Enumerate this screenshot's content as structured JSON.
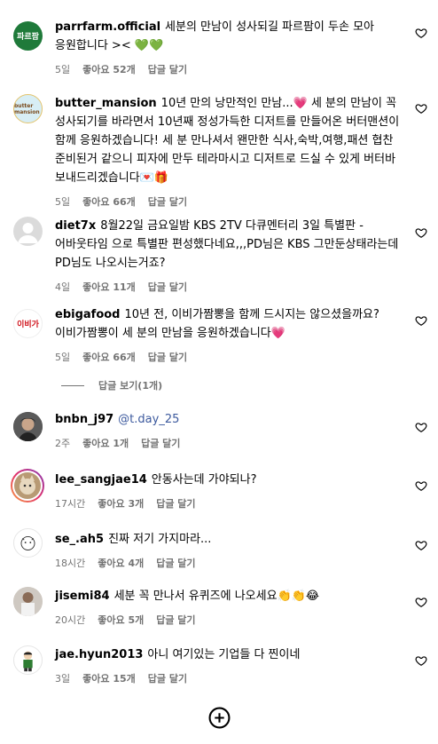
{
  "comments": [
    {
      "username": "parrfarm.official",
      "text": "세분의 만남이 성사되길 파르팜이 두손 모아 응원합니다 >< 💚💚",
      "time": "5일",
      "likes": "좋아요 52개",
      "reply": "답글 달기",
      "avatar_text": "파르팜",
      "avatar_icon": "parrfarm-logo-avatar"
    },
    {
      "username": "butter_mansion",
      "text": "10년 만의 낭만적인 만남...💗 세 분의 만남이 꼭 성사되기를 바라면서 10년째 정성가득한 디저트를 만들어온 버터맨션이 함께 응원하겠습니다! 세 분 만나셔서 왠만한 식사,숙박,여행,패션 협찬 준비된거 같으니 피자에 만두 테라마시고 디저트로 드실 수 있게 버터바 보내드리겠습니다💌🎁",
      "time": "5일",
      "likes": "좋아요 66개",
      "reply": "답글 달기",
      "avatar_text": "butter mansion",
      "avatar_icon": "butter-mansion-logo-avatar"
    },
    {
      "username": "diet7x",
      "text": "8월22일 금요일밤 KBS 2TV 다큐멘터리 3일 특별판 -어바웃타임 으로 특별판 편성했다네요,,,PD님은 KBS 그만둔상태라는데 PD님도 나오시는거죠?",
      "time": "4일",
      "likes": "좋아요 11개",
      "reply": "답글 달기",
      "avatar_icon": "default-user-avatar"
    },
    {
      "username": "ebigafood",
      "text": "10년 전, 이비가짬뽕을 함께 드시지는 않으셨을까요? 이비가짬뽕이 세 분의 만남을 응원하겠습니다💗",
      "time": "5일",
      "likes": "좋아요 66개",
      "reply": "답글 달기",
      "avatar_text": "이비가",
      "avatar_icon": "ebigafood-logo-avatar"
    }
  ],
  "view_replies": "답글 보기(1개)",
  "replies_lower": [
    {
      "username": "bnbn_j97",
      "mention": "@t.day_25",
      "text": "",
      "time": "2주",
      "likes": "좋아요 1개",
      "reply": "답글 달기",
      "avatar_icon": "photo-avatar"
    },
    {
      "username": "lee_sangjae14",
      "text": "안동사는데 가야되나?",
      "time": "17시간",
      "likes": "좋아요 3개",
      "reply": "답글 달기",
      "avatar_icon": "cat-photo-avatar"
    },
    {
      "username": "se_.ah5",
      "text": "진짜 저기 가지마라...",
      "time": "18시간",
      "likes": "좋아요 4개",
      "reply": "답글 달기",
      "avatar_icon": "cartoon-avatar"
    },
    {
      "username": "jisemi84",
      "text": "세분 꼭 만나서 유퀴즈에 나오세요👏👏😂",
      "time": "20시간",
      "likes": "좋아요 5개",
      "reply": "답글 달기",
      "avatar_icon": "photo-avatar"
    },
    {
      "username": "jae.hyun2013",
      "text": "아니 여기있는 기업들 다 찐이네",
      "time": "3일",
      "likes": "좋아요 15개",
      "reply": "답글 달기",
      "avatar_icon": "character-avatar"
    }
  ],
  "icons": {
    "heart": "heart-outline-icon",
    "add": "add-circle-icon"
  },
  "colors": {
    "mention": "#3d5a9e",
    "meta": "#737373",
    "parrfarm_green": "#1f7a3a"
  }
}
